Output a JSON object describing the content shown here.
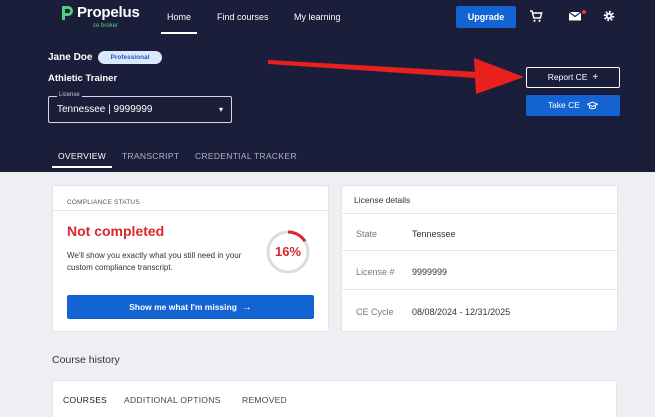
{
  "brand": {
    "name": "Propelus",
    "subtitle": "ce broker",
    "colors": {
      "navy": "#1b1e3a",
      "primary": "#1364d2",
      "alert": "#d9262c",
      "logo_green": "#4ed07a"
    }
  },
  "nav": {
    "links": [
      "Home",
      "Find courses",
      "My learning"
    ],
    "active": "Home",
    "upgrade_label": "Upgrade",
    "icons": [
      "cart-icon",
      "mail-icon",
      "gear-icon"
    ]
  },
  "user": {
    "name": "Jane Doe",
    "plan_badge": "Professional",
    "profession": "Athletic Trainer",
    "license_legend": "License",
    "license_value": "Tennessee | 9999999"
  },
  "actions": {
    "report_label": "Report CE",
    "report_icon": "plus-icon",
    "take_label": "Take CE",
    "take_icon": "graduation-cap-icon"
  },
  "dashboard_tabs": {
    "items": [
      "OVERVIEW",
      "TRANSCRIPT",
      "CREDENTIAL TRACKER"
    ],
    "active": "OVERVIEW"
  },
  "compliance": {
    "header": "COMPLIANCE STATUS",
    "status": "Not completed",
    "description": "We'll show you exactly what you still need in your custom compliance transcript.",
    "progress_percent": 16,
    "progress_label": "16%",
    "button_label": "Show me what I'm missing",
    "button_icon": "arrow-right-icon"
  },
  "license_details": {
    "title": "License details",
    "rows": [
      {
        "label": "State",
        "value": "Tennessee"
      },
      {
        "label": "License #",
        "value": "9999999"
      },
      {
        "label": "CE Cycle",
        "value": "08/08/2024 - 12/31/2025"
      }
    ]
  },
  "course_history": {
    "title": "Course history",
    "tabs": [
      "COURSES",
      "ADDITIONAL OPTIONS",
      "REMOVED"
    ],
    "active": "COURSES"
  },
  "annotation": {
    "type": "red-arrow",
    "color": "#e8211d",
    "points_to": "report-ce-button"
  }
}
